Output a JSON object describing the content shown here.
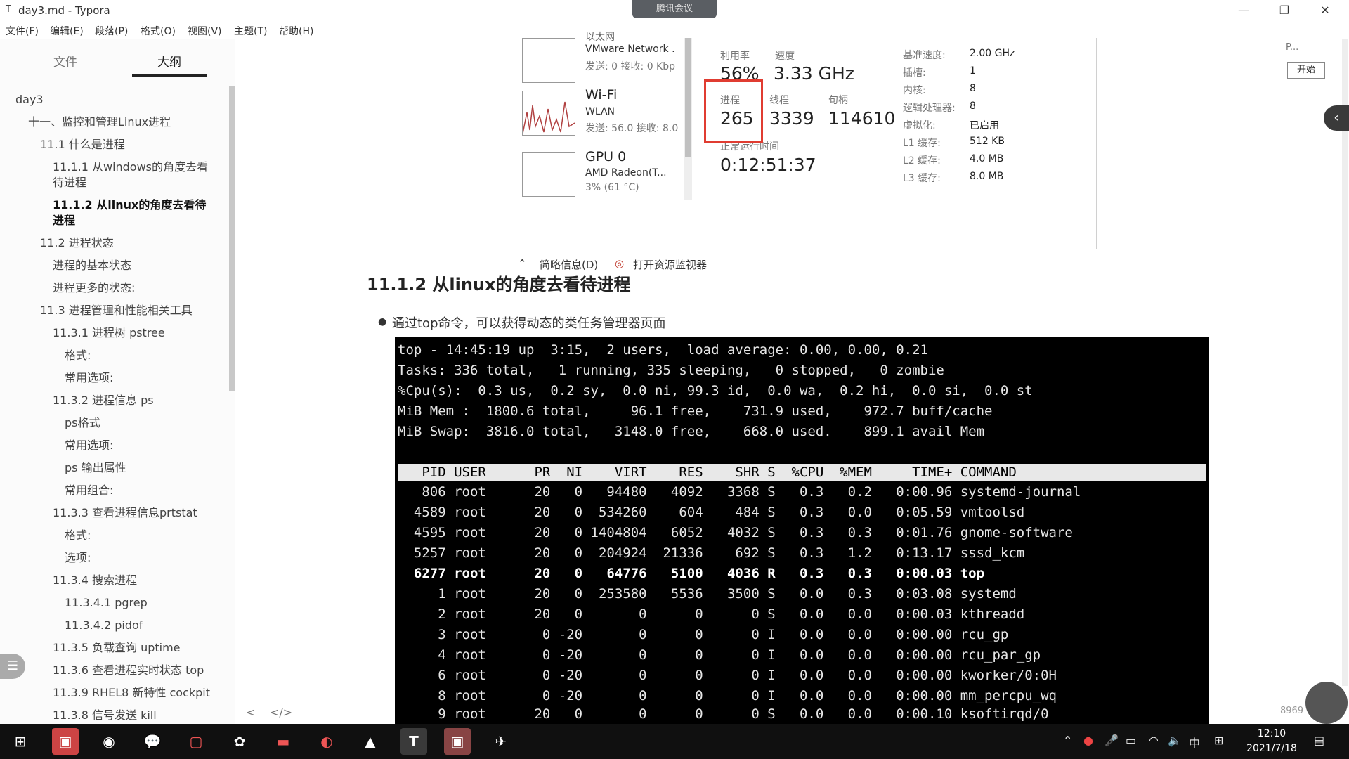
{
  "window": {
    "title": "day3.md - Typora",
    "meeting_badge": "腾讯会议",
    "controls": [
      "—",
      "❐",
      "✕"
    ]
  },
  "menu": [
    "文件(F)",
    "编辑(E)",
    "段落(P)",
    "格式(O)",
    "视图(V)",
    "主题(T)",
    "帮助(H)"
  ],
  "sidebar": {
    "tabs": [
      {
        "label": "文件"
      },
      {
        "label": "大纲"
      }
    ],
    "active_tab": "大纲",
    "outline": [
      {
        "label": "day3",
        "level": 0
      },
      {
        "label": "十一、监控和管理Linux进程",
        "level": 1
      },
      {
        "label": "11.1 什么是进程",
        "level": 2
      },
      {
        "label": "11.1.1 从windows的角度去看",
        "level": 3
      },
      {
        "label": "待进程",
        "level": 3
      },
      {
        "label": "11.1.2 从linux的角度去看待",
        "level": 3,
        "bold": true
      },
      {
        "label": "进程",
        "level": 3,
        "bold": true
      },
      {
        "label": "11.2 进程状态",
        "level": 2
      },
      {
        "label": "进程的基本状态",
        "level": 3
      },
      {
        "label": "进程更多的状态:",
        "level": 3
      },
      {
        "label": "11.3 进程管理和性能相关工具",
        "level": 2
      },
      {
        "label": "11.3.1 进程树 pstree",
        "level": 3
      },
      {
        "label": "格式:",
        "level": 4
      },
      {
        "label": "常用选项:",
        "level": 4
      },
      {
        "label": "11.3.2 进程信息 ps",
        "level": 3
      },
      {
        "label": "ps格式",
        "level": 4
      },
      {
        "label": "常用选项:",
        "level": 4
      },
      {
        "label": "ps 输出属性",
        "level": 4
      },
      {
        "label": "常用组合:",
        "level": 4
      },
      {
        "label": "11.3.3 查看进程信息prtstat",
        "level": 3
      },
      {
        "label": "格式:",
        "level": 4
      },
      {
        "label": "选项:",
        "level": 4
      },
      {
        "label": "11.3.4 搜索进程",
        "level": 3
      },
      {
        "label": "11.3.4.1 pgrep",
        "level": 4
      },
      {
        "label": "11.3.4.2 pidof",
        "level": 4
      },
      {
        "label": "11.3.5 负载查询 uptime",
        "level": 3
      },
      {
        "label": "11.3.6 查看进程实时状态 top",
        "level": 3
      },
      {
        "label": "11.3.9 RHEL8 新特性 cockpit",
        "level": 3
      },
      {
        "label": "11.3.8 信号发送 kill",
        "level": 3
      }
    ],
    "bottom_controls": [
      "<",
      "</>"
    ]
  },
  "task_manager": {
    "devices": [
      {
        "name": "以太网",
        "sub": "VMware Network .",
        "stats": "发送: 0 接收: 0 Kbp"
      },
      {
        "name": "Wi-Fi",
        "sub": "WLAN",
        "stats": "发送: 56.0 接收: 8.0"
      },
      {
        "name": "GPU 0",
        "sub": "AMD Radeon(T...",
        "stats": "3% (61 °C)"
      }
    ],
    "labels": {
      "utilization": "利用率",
      "speed": "速度",
      "processes": "进程",
      "threads": "线程",
      "handles": "句柄",
      "uptime": "正常运行时间"
    },
    "values": {
      "utilization": "56%",
      "speed": "3.33 GHz",
      "processes": "265",
      "threads": "3339",
      "handles": "114610",
      "uptime": "0:12:51:37"
    },
    "specs": [
      {
        "k": "基准速度:",
        "v": "2.00 GHz"
      },
      {
        "k": "插槽:",
        "v": "1"
      },
      {
        "k": "内核:",
        "v": "8"
      },
      {
        "k": "逻辑处理器:",
        "v": "8"
      },
      {
        "k": "虚拟化:",
        "v": "已启用"
      },
      {
        "k": "L1 缓存:",
        "v": "512 KB"
      },
      {
        "k": "L2 缓存:",
        "v": "4.0 MB"
      },
      {
        "k": "L3 缓存:",
        "v": "8.0 MB"
      }
    ],
    "footer": {
      "brief": "简略信息(D)",
      "monitor": "打开资源监视器"
    }
  },
  "document": {
    "heading": "11.1.2 从linux的角度去看待进程",
    "bullet": "通过top命令，可以获得动态的类任务管理器页面"
  },
  "terminal": {
    "summary": [
      "top - 14:45:19 up  3:15,  2 users,  load average: 0.00, 0.00, 0.21",
      "Tasks: 336 total,   1 running, 335 sleeping,   0 stopped,   0 zombie",
      "%Cpu(s):  0.3 us,  0.2 sy,  0.0 ni, 99.3 id,  0.0 wa,  0.2 hi,  0.0 si,  0.0 st",
      "MiB Mem :  1800.6 total,     96.1 free,    731.9 used,    972.7 buff/cache",
      "MiB Swap:  3816.0 total,   3148.0 free,    668.0 used.    899.1 avail Mem"
    ],
    "header": "   PID USER      PR  NI    VIRT    RES    SHR S  %CPU  %MEM     TIME+ COMMAND",
    "rows": [
      {
        "text": "   806 root      20   0   94480   4092   3368 S   0.3   0.2   0:00.96 systemd-journal"
      },
      {
        "text": "  4589 root      20   0  534260    604    484 S   0.3   0.0   0:05.59 vmtoolsd"
      },
      {
        "text": "  4595 root      20   0 1404804   6052   4032 S   0.3   0.3   0:01.76 gnome-software"
      },
      {
        "text": "  5257 root      20   0  204924  21336    692 S   0.3   1.2   0:13.17 sssd_kcm"
      },
      {
        "text": "  6277 root      20   0   64776   5100   4036 R   0.3   0.3   0:00.03 top",
        "bold": true
      },
      {
        "text": "     1 root      20   0  253580   5536   3500 S   0.0   0.3   0:03.08 systemd"
      },
      {
        "text": "     2 root      20   0       0      0      0 S   0.0   0.0   0:00.03 kthreadd"
      },
      {
        "text": "     3 root       0 -20       0      0      0 I   0.0   0.0   0:00.00 rcu_gp"
      },
      {
        "text": "     4 root       0 -20       0      0      0 I   0.0   0.0   0:00.00 rcu_par_gp"
      },
      {
        "text": "     6 root       0 -20       0      0      0 I   0.0   0.0   0:00.00 kworker/0:0H"
      },
      {
        "text": "     8 root       0 -20       0      0      0 I   0.0   0.0   0:00.00 mm_percpu_wq"
      },
      {
        "text": "     9 root      20   0       0      0      0 S   0.0   0.0   0:00.10 ksoftirqd/0"
      }
    ]
  },
  "right_panel": {
    "small": "P...",
    "start": "开始",
    "number": "8969"
  },
  "taskbar": {
    "time": "12:10",
    "date": "2021/7/18",
    "ime": "中",
    "icons": [
      "windows-start-icon",
      "app-icon",
      "chrome-icon",
      "wechat-icon",
      "app-icon",
      "app-icon",
      "folder-icon",
      "app-icon",
      "photos-icon",
      "typora-icon",
      "app-icon",
      "app-icon"
    ]
  },
  "colors": {
    "highlight_box": "#e03c31",
    "terminal_bg": "#000000",
    "taskbar_bg": "#101010"
  }
}
